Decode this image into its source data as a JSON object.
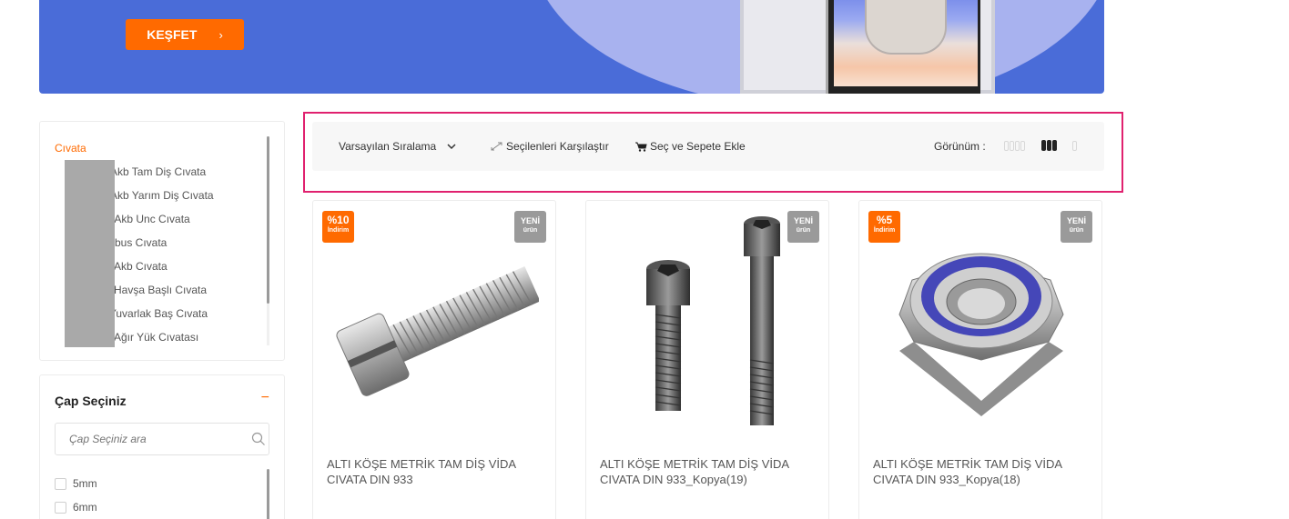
{
  "banner": {
    "cta_label": "KEŞFET",
    "cta_icon": "chevron-right-icon"
  },
  "sidebar": {
    "category_title": "Cıvata",
    "categories": [
      "Akb Tam Diş Cıvata",
      "Akb Yarım Diş Cıvata",
      "n Akb Unc Cıvata",
      "mbus Cıvata",
      "Akb Cıvata",
      "Havşa Başlı Cıvata",
      "Yuvarlak Baş Cıvata",
      "Ağır Yük Cıvatası"
    ],
    "filter": {
      "title": "Çap Seçiniz",
      "collapse_icon": "minus-icon",
      "search_placeholder": "Çap Seçiniz ara",
      "options": [
        "5mm",
        "6mm"
      ]
    }
  },
  "toolbar": {
    "sort_label": "Varsayılan Sıralama",
    "compare_label": "Seçilenleri Karşılaştır",
    "add_to_cart_label": "Seç ve Sepete Ekle",
    "view_label": "Görünüm :",
    "active_view": "3-column",
    "highlight_color": "#e0216f"
  },
  "products": [
    {
      "discount": "%10",
      "discount_label": "İndirim",
      "new_badge": "YENİ",
      "new_badge_sub": "ürün",
      "name": "ALTI KÖŞE METRİK TAM DİŞ VİDA CIVATA DIN 933",
      "image": "slotted-bolt"
    },
    {
      "discount": "",
      "discount_label": "",
      "new_badge": "YENİ",
      "new_badge_sub": "ürün",
      "name": "ALTI KÖŞE METRİK TAM DİŞ VİDA CIVATA DIN 933_Kopya(19)",
      "image": "socket-cap-screws"
    },
    {
      "discount": "%5",
      "discount_label": "İndirim",
      "new_badge": "YENİ",
      "new_badge_sub": "ürün",
      "name": "ALTI KÖŞE METRİK TAM DİŞ VİDA CIVATA DIN 933_Kopya(18)",
      "image": "nylon-lock-nut"
    }
  ],
  "colors": {
    "accent": "#ff6a00",
    "banner_blue": "#4a6cd8",
    "new_badge": "#9a9a9a"
  }
}
